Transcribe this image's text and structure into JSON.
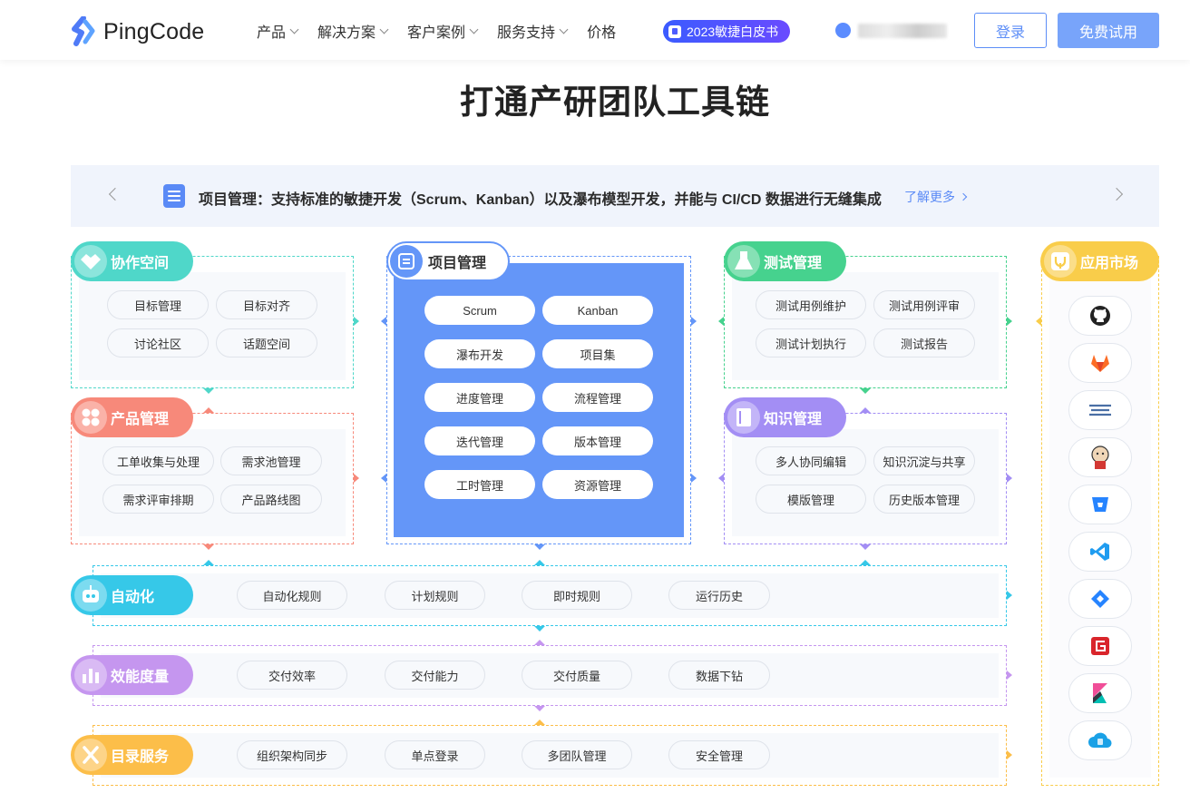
{
  "header": {
    "logo_text": "PingCode",
    "nav": [
      "产品",
      "解决方案",
      "客户案例",
      "服务支持",
      "价格"
    ],
    "badge": "2023敏捷白皮书",
    "login": "登录",
    "trial": "免费试用"
  },
  "title": "打通产研团队工具链",
  "banner": {
    "text": "项目管理：支持标准的敏捷开发（Scrum、Kanban）以及瀑布模型开发，并能与 CI/CD 数据进行无缝集成",
    "more": "了解更多"
  },
  "modules": {
    "collab": {
      "title": "协作空间",
      "items": [
        "目标管理",
        "目标对齐",
        "讨论社区",
        "话题空间"
      ]
    },
    "product": {
      "title": "产品管理",
      "items": [
        "工单收集与处理",
        "需求池管理",
        "需求评审排期",
        "产品路线图"
      ]
    },
    "project": {
      "title": "项目管理",
      "items": [
        "Scrum",
        "Kanban",
        "瀑布开发",
        "项目集",
        "进度管理",
        "流程管理",
        "迭代管理",
        "版本管理",
        "工时管理",
        "资源管理"
      ]
    },
    "test": {
      "title": "测试管理",
      "items": [
        "测试用例维护",
        "测试用例评审",
        "测试计划执行",
        "测试报告"
      ]
    },
    "knowledge": {
      "title": "知识管理",
      "items": [
        "多人协同编辑",
        "知识沉淀与共享",
        "模版管理",
        "历史版本管理"
      ]
    },
    "market": {
      "title": "应用市场",
      "apps": [
        "github-icon",
        "gitlab-icon",
        "harbor-icon",
        "jenkins-icon",
        "bitbucket-icon",
        "vscode-icon",
        "jira-icon",
        "gitee-icon",
        "kibana-icon",
        "cloud-icon"
      ]
    },
    "automation": {
      "title": "自动化",
      "items": [
        "自动化规则",
        "计划规则",
        "即时规则",
        "运行历史"
      ]
    },
    "efficiency": {
      "title": "效能度量",
      "items": [
        "交付效率",
        "交付能力",
        "交付质量",
        "数据下钻"
      ]
    },
    "directory": {
      "title": "目录服务",
      "items": [
        "组织架构同步",
        "单点登录",
        "多团队管理",
        "安全管理"
      ]
    }
  },
  "colors": {
    "collab": "#4fd7c9",
    "product": "#f7897a",
    "project": "#6496f8",
    "test": "#46d28e",
    "knowledge": "#a38ef4",
    "market": "#f9cd4a",
    "automation": "#36c8e8",
    "efficiency": "#c596ef",
    "directory": "#fcbe49"
  }
}
